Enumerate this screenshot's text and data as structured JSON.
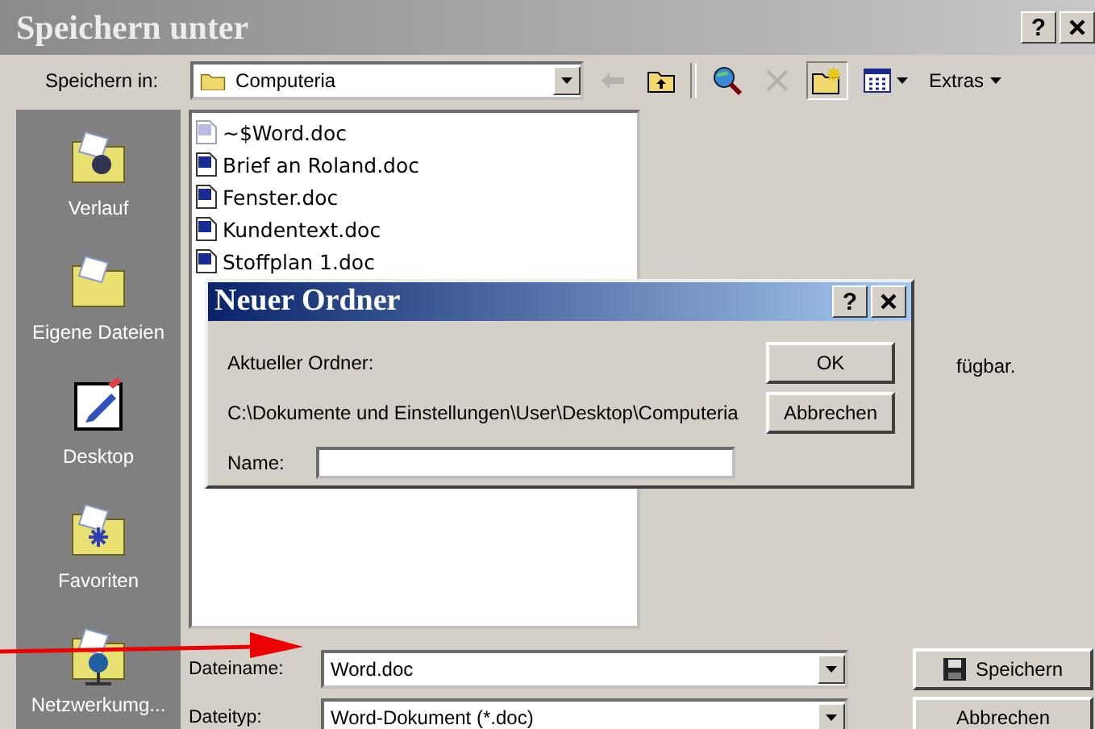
{
  "window": {
    "title": "Speichern unter",
    "help": "?"
  },
  "toolbar": {
    "label": "Speichern in:",
    "location": "Computeria",
    "tools": [
      {
        "kind": "back",
        "disabled": true
      },
      {
        "kind": "up",
        "disabled": false
      },
      {
        "kind": "web-search",
        "disabled": false
      },
      {
        "kind": "delete",
        "disabled": true
      },
      {
        "kind": "new-folder",
        "disabled": false,
        "pressed": true
      },
      {
        "kind": "views",
        "disabled": false
      }
    ],
    "menu": "Extras"
  },
  "places": [
    {
      "label": "Verlauf",
      "kind": "history"
    },
    {
      "label": "Eigene Dateien",
      "kind": "documents"
    },
    {
      "label": "Desktop",
      "kind": "desktop"
    },
    {
      "label": "Favoriten",
      "kind": "favorites"
    },
    {
      "label": "Netzwerkumg...",
      "kind": "network"
    }
  ],
  "files": [
    {
      "name": "~$Word.doc",
      "hidden": true
    },
    {
      "name": "Brief an Roland.doc",
      "hidden": false
    },
    {
      "name": "Fenster.doc",
      "hidden": false
    },
    {
      "name": "Kundentext.doc",
      "hidden": false
    },
    {
      "name": "Stoffplan 1.doc",
      "hidden": false
    }
  ],
  "preview_text": "fügbar.",
  "form": {
    "filename_label": "Dateiname:",
    "filename": "Word.doc",
    "filetype_label": "Dateityp:",
    "filetype": "Word-Dokument (*.doc)",
    "save": "Speichern",
    "cancel": "Abbrechen"
  },
  "dialog": {
    "title": "Neuer Ordner",
    "help": "?",
    "current_label": "Aktueller Ordner:",
    "path": "C:\\Dokumente und Einstellungen\\User\\Desktop\\Computeria",
    "name_label": "Name:",
    "ok": "OK",
    "cancel": "Abbrechen"
  }
}
